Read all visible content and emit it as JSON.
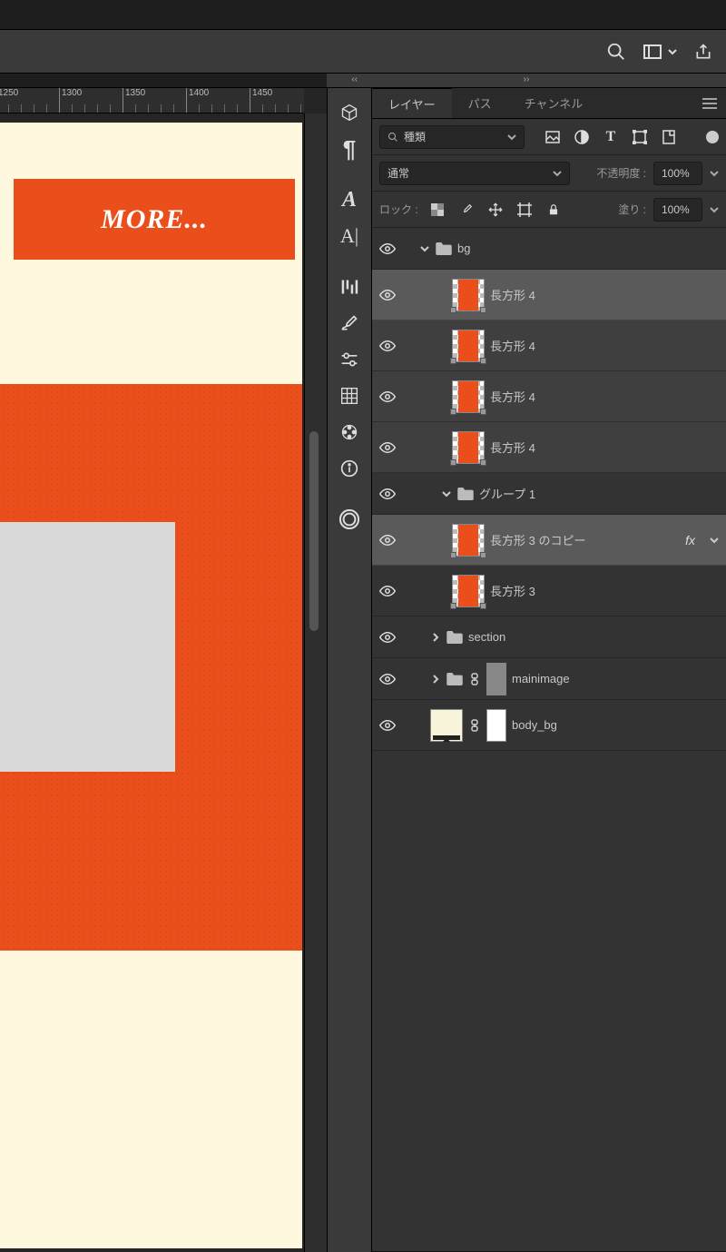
{
  "ruler": {
    "ticks": [
      "1250",
      "1300",
      "1350",
      "1400",
      "1450"
    ]
  },
  "canvas": {
    "button_text": "MORE..."
  },
  "tabs": {
    "layers": "レイヤー",
    "paths": "パス",
    "channels": "チャンネル"
  },
  "filter": {
    "kind_label": "種類"
  },
  "blend": {
    "mode": "通常",
    "opacity_label": "不透明度 :",
    "opacity_value": "100%"
  },
  "lock": {
    "label": "ロック :",
    "fill_label": "塗り :",
    "fill_value": "100%"
  },
  "layers": {
    "bg_group": "bg",
    "rect4": "長方形 4",
    "group1": "グループ 1",
    "rect3_copy": "長方形 3 のコピー",
    "rect3": "長方形 3",
    "section": "section",
    "mainimage": "mainimage",
    "body_bg": "body_bg",
    "fx": "fx"
  }
}
